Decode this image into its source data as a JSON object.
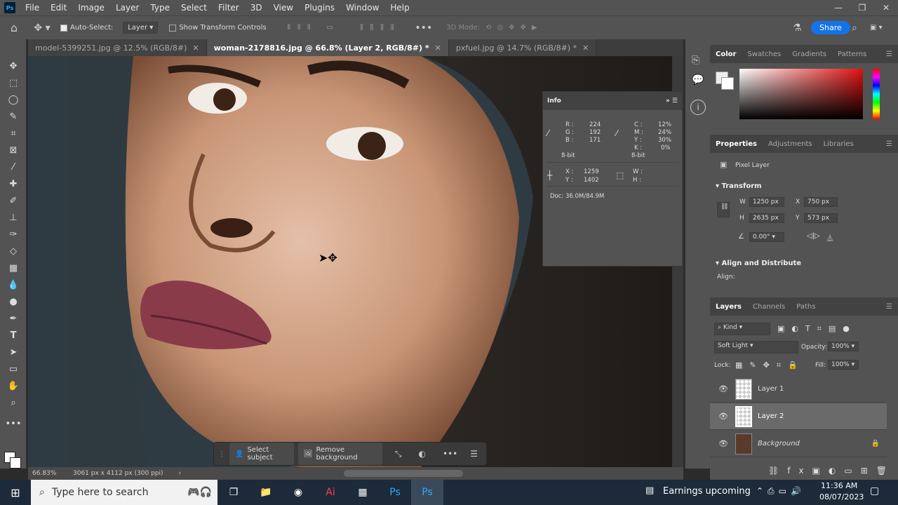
{
  "app": {
    "logo_text": "Ps",
    "brand_color": "#31a8ff"
  },
  "menu": [
    "File",
    "Edit",
    "Image",
    "Layer",
    "Type",
    "Select",
    "Filter",
    "3D",
    "View",
    "Plugins",
    "Window",
    "Help"
  ],
  "window_controls": {
    "minimize": "—",
    "restore": "❐",
    "close": "✕"
  },
  "options_bar": {
    "auto_select_label": "Auto-Select:",
    "auto_select_checked": true,
    "auto_select_target": "Layer",
    "show_transform_label": "Show Transform Controls",
    "mode_3d_label": "3D Mode:",
    "share_label": "Share"
  },
  "tabs": [
    {
      "label": "model-5399251.jpg @ 12.5% (RGB/8#)",
      "active": false
    },
    {
      "label": "woman-2178816.jpg @ 66.8% (Layer 2, RGB/8#) *",
      "active": true
    },
    {
      "label": "pxfuel.jpg @ 14.7% (RGB/8#) *",
      "active": false
    }
  ],
  "info_panel": {
    "title": "Info",
    "rgb": {
      "R": "224",
      "G": "192",
      "B": "171"
    },
    "rgb_bits": "8-bit",
    "cmyk": {
      "C": "12%",
      "M": "24%",
      "Y": "30%",
      "K": "0%"
    },
    "cmyk_bits": "8-bit",
    "x": "1259",
    "y": "1402",
    "w": "",
    "h": "",
    "doc": "Doc: 36.0M/84.9M"
  },
  "status": {
    "zoom": "66.83%",
    "doc_info": "3061 px x 4112 px (300 ppi)"
  },
  "context_bar": {
    "select_subject": "Select subject",
    "remove_background": "Remove background"
  },
  "color_panel": {
    "tabs": [
      "Color",
      "Swatches",
      "Gradients",
      "Patterns"
    ],
    "active": "Color"
  },
  "properties_panel": {
    "tabs": [
      "Properties",
      "Adjustments",
      "Libraries"
    ],
    "active": "Properties",
    "layer_type": "Pixel Layer",
    "transform_label": "Transform",
    "w_label": "W",
    "w": "1250 px",
    "h_label": "H",
    "h": "2635 px",
    "x_label": "X",
    "x": "750 px",
    "y_label": "Y",
    "y": "573 px",
    "angle": "0.00°",
    "align_label": "Align and Distribute",
    "align_sub": "Align:"
  },
  "layers_panel": {
    "tabs": [
      "Layers",
      "Channels",
      "Paths"
    ],
    "active": "Layers",
    "kind": "Kind",
    "blend_mode": "Soft Light",
    "opacity_label": "Opacity:",
    "opacity": "100%",
    "lock_label": "Lock:",
    "fill_label": "Fill:",
    "fill": "100%",
    "layers": [
      {
        "name": "Layer 1",
        "selected": false,
        "italic": false,
        "locked": false
      },
      {
        "name": "Layer 2",
        "selected": true,
        "italic": false,
        "locked": false
      },
      {
        "name": "Background",
        "selected": false,
        "italic": true,
        "locked": true
      }
    ]
  },
  "taskbar": {
    "search_placeholder": "Type here to search",
    "news": "Earnings upcoming",
    "time": "11:36 AM",
    "date": "08/07/2023"
  }
}
